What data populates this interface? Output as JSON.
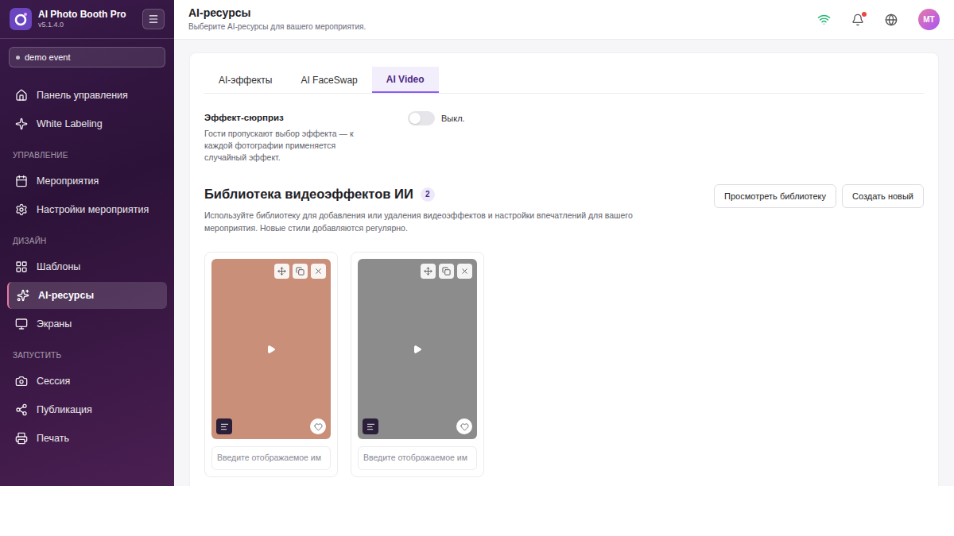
{
  "app": {
    "name": "AI Photo Booth Pro",
    "version": "v5.1.4.0"
  },
  "event_selector": {
    "label": "demo event"
  },
  "sidebar": {
    "sections": [
      {
        "title": "",
        "items": [
          {
            "label": "Панель управления",
            "icon": "home",
            "selected": false
          },
          {
            "label": "White Labeling",
            "icon": "sparkle",
            "selected": false
          }
        ]
      },
      {
        "title": "УПРАВЛЕНИЕ",
        "items": [
          {
            "label": "Мероприятия",
            "icon": "calendar",
            "selected": false
          },
          {
            "label": "Настройки мероприятия",
            "icon": "settings",
            "selected": false
          }
        ]
      },
      {
        "title": "ДИЗАЙН",
        "items": [
          {
            "label": "Шаблоны",
            "icon": "grid",
            "selected": false
          },
          {
            "label": "AI-ресурсы",
            "icon": "sparkles",
            "selected": true
          },
          {
            "label": "Экраны",
            "icon": "monitor",
            "selected": false
          }
        ]
      },
      {
        "title": "ЗАПУСТИТЬ",
        "items": [
          {
            "label": "Сессия",
            "icon": "camera",
            "selected": false
          },
          {
            "label": "Публикация",
            "icon": "share",
            "selected": false
          },
          {
            "label": "Печать",
            "icon": "printer",
            "selected": false
          }
        ]
      }
    ]
  },
  "header": {
    "title": "AI-ресурсы",
    "subtitle": "Выберите AI-ресурсы для вашего мероприятия.",
    "avatar": "MT",
    "notification": true,
    "online": true
  },
  "tabs": [
    {
      "label": "AI-эффекты",
      "selected": false
    },
    {
      "label": "AI FaceSwap",
      "selected": false
    },
    {
      "label": "AI Video",
      "selected": true
    }
  ],
  "surprise": {
    "title": "Эффект-сюрприз",
    "description": "Гости пропускают выбор эффекта — к каждой фотографии применяется случайный эффект.",
    "on": false,
    "state_label": "Выкл."
  },
  "library": {
    "title": "Библиотека видеоэффектов ИИ",
    "count": "2",
    "description": "Используйте библиотеку для добавления или удаления видеоэффектов и настройки впечатлений для вашего мероприятия. Новые стили добавляются регулярно.",
    "buttons": [
      "Просмотреть библиотеку",
      "Создать новый"
    ],
    "cards": [
      {
        "placeholder": "Введите отображаемое им",
        "color": "#c98f78",
        "favorite": false
      },
      {
        "placeholder": "Введите отображаемое им",
        "color": "#8c8c8c",
        "favorite": false
      }
    ]
  }
}
